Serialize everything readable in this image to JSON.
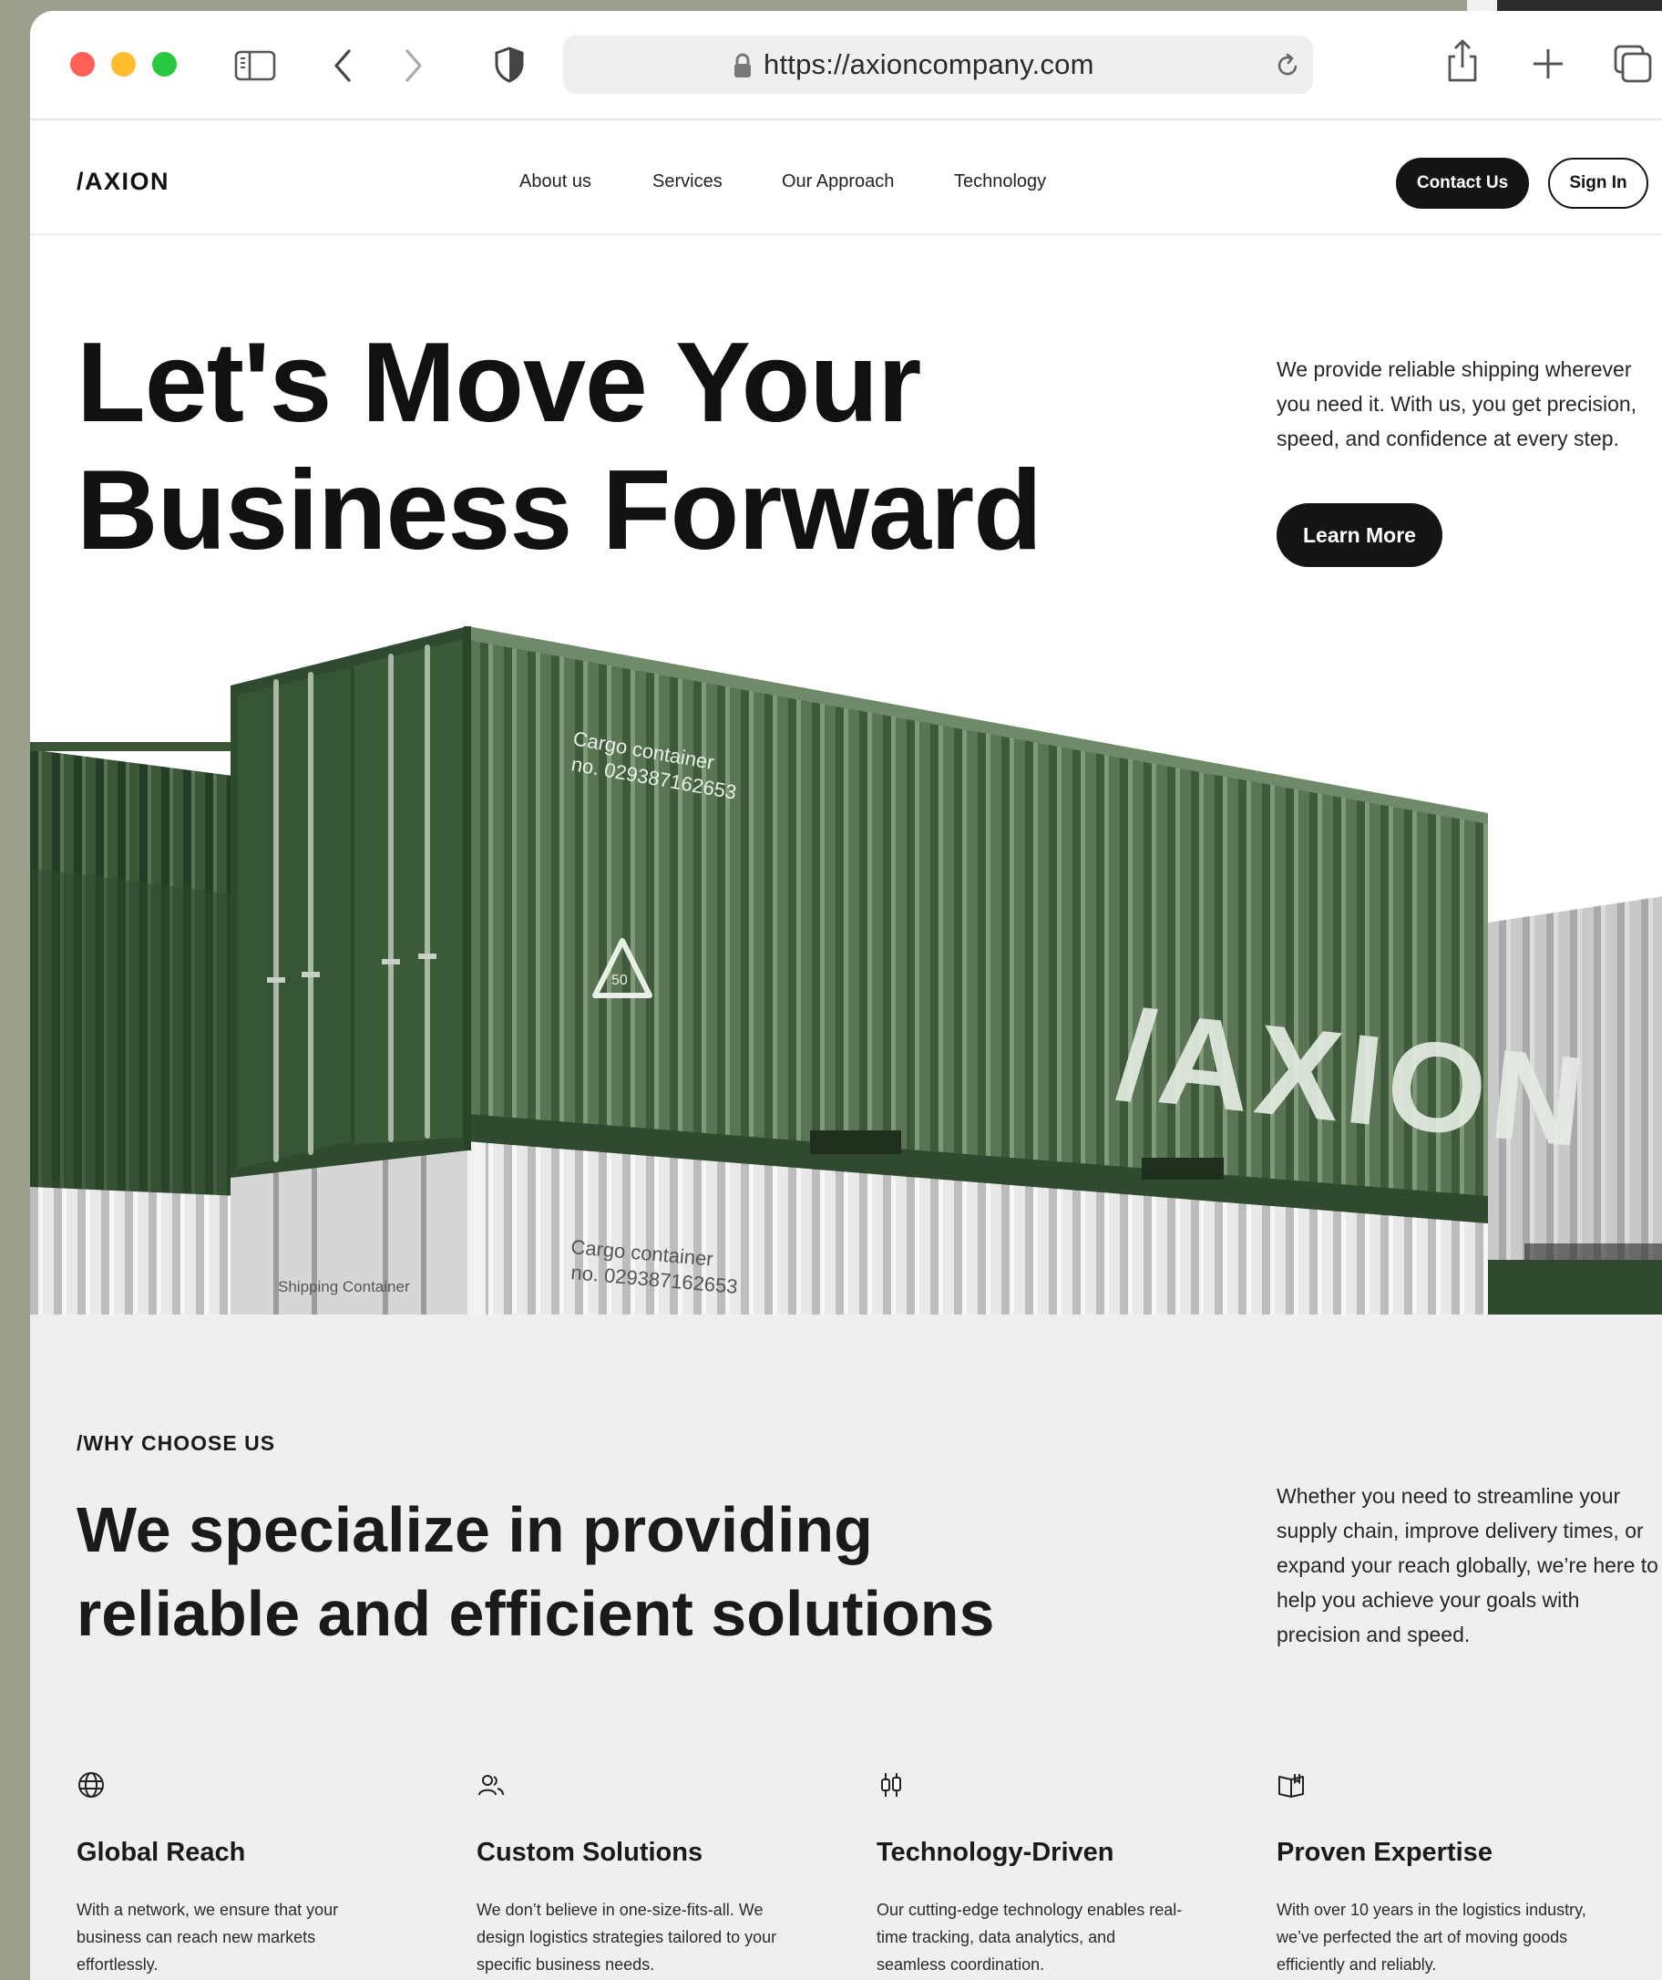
{
  "browser": {
    "url": "https://axioncompany.com",
    "traffic_lights": {
      "close": "#ff5f57",
      "minimize": "#febc2e",
      "zoom": "#28c840"
    },
    "icons": [
      "sidebar-icon",
      "back-icon",
      "forward-icon",
      "shield-icon",
      "lock-icon",
      "reload-icon",
      "share-icon",
      "new-tab-icon",
      "tabs-icon"
    ]
  },
  "nav": {
    "logo": "/AXION",
    "links": [
      "About us",
      "Services",
      "Our Approach",
      "Technology"
    ],
    "contact_label": "Contact Us",
    "signin_label": "Sign In"
  },
  "hero": {
    "title_line1": "Let's Move Your",
    "title_line2": "Business Forward",
    "description": "We provide reliable shipping wherever you need it. With us, you get precision, speed, and confidence at every step.",
    "cta_label": "Learn More",
    "image": {
      "container_label_1": "Cargo container",
      "container_label_2": "no. 029387162653",
      "brand_mark": "/AXION",
      "recycle_number": "50",
      "side_label": "Shipping Container",
      "colors": {
        "green": "#55704f",
        "dark_green": "#2f4a2e",
        "white_container": "#dcdcdc"
      }
    }
  },
  "why": {
    "kicker": "/WHY CHOOSE US",
    "title_line1": "We specialize in providing",
    "title_line2": "reliable and efficient solutions",
    "description": "Whether you need to streamline your supply chain, improve delivery times, or expand your reach globally, we’re here to help you achieve your goals with precision and speed.",
    "features": [
      {
        "icon": "globe-icon",
        "title": "Global Reach",
        "text": "With a network, we ensure that your business can reach new markets effortlessly."
      },
      {
        "icon": "users-icon",
        "title": "Custom Solutions",
        "text": "We don’t believe in one-size-fits-all. We design logistics strategies tailored to your specific business needs."
      },
      {
        "icon": "candlestick-icon",
        "title": "Technology-Driven",
        "text": "Our cutting-edge technology enables real-time tracking, data analytics, and seamless coordination."
      },
      {
        "icon": "book-icon",
        "title": "Proven Expertise",
        "text": "With over 10 years in the logistics industry, we’ve perfected the art of moving goods efficiently and reliably."
      }
    ]
  }
}
